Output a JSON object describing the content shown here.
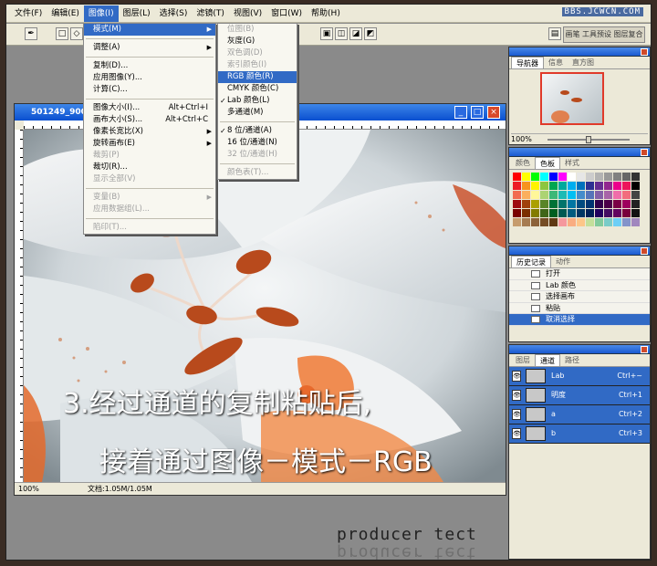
{
  "menubar": {
    "items": [
      "文件(F)",
      "编辑(E)",
      "图像(I)",
      "图层(L)",
      "选择(S)",
      "滤镜(T)",
      "视图(V)",
      "窗口(W)",
      "帮助(H)"
    ],
    "watermark": "BBS.JCWCN.COM"
  },
  "optbar": {
    "palette_well": "画笔 工具预设 图层复合"
  },
  "document": {
    "title": "501249_900",
    "zoom": "100%",
    "doc_info": "文档:1.05M/1.05M"
  },
  "image_menu": {
    "items": [
      {
        "label": "模式(M)",
        "arrow": true,
        "highlight": true
      },
      {
        "sep": true
      },
      {
        "label": "调整(A)",
        "arrow": true
      },
      {
        "sep": true
      },
      {
        "label": "复制(D)..."
      },
      {
        "label": "应用图像(Y)..."
      },
      {
        "label": "计算(C)..."
      },
      {
        "sep": true
      },
      {
        "label": "图像大小(I)...",
        "shortcut": "Alt+Ctrl+I"
      },
      {
        "label": "画布大小(S)...",
        "shortcut": "Alt+Ctrl+C"
      },
      {
        "label": "像素长宽比(X)",
        "arrow": true
      },
      {
        "label": "旋转画布(E)",
        "arrow": true
      },
      {
        "label": "裁剪(P)",
        "disabled": true
      },
      {
        "label": "裁切(R)..."
      },
      {
        "label": "显示全部(V)",
        "disabled": true
      },
      {
        "sep": true
      },
      {
        "label": "变量(B)",
        "arrow": true,
        "disabled": true
      },
      {
        "label": "应用数据组(L)...",
        "disabled": true
      },
      {
        "sep": true
      },
      {
        "label": "陷印(T)...",
        "disabled": true
      }
    ]
  },
  "mode_menu": {
    "items": [
      {
        "label": "位图(B)",
        "disabled": true
      },
      {
        "label": "灰度(G)"
      },
      {
        "label": "双色调(D)",
        "disabled": true
      },
      {
        "label": "索引颜色(I)",
        "disabled": true
      },
      {
        "label": "RGB 颜色(R)",
        "highlight": true
      },
      {
        "label": "CMYK 颜色(C)"
      },
      {
        "label": "Lab 颜色(L)",
        "checked": true
      },
      {
        "label": "多通道(M)"
      },
      {
        "sep": true
      },
      {
        "label": "8 位/通道(A)",
        "checked": true
      },
      {
        "label": "16 位/通道(N)"
      },
      {
        "label": "32 位/通道(H)",
        "disabled": true
      },
      {
        "sep": true
      },
      {
        "label": "颜色表(T)...",
        "disabled": true
      }
    ]
  },
  "navigator": {
    "tabs": [
      "导航器",
      "信息",
      "直方图"
    ],
    "zoom": "100%"
  },
  "color_panel": {
    "tabs": [
      "颜色",
      "色板",
      "样式"
    ],
    "swatches": [
      "#ff0000",
      "#ffff00",
      "#00ff00",
      "#00ffff",
      "#0000ff",
      "#ff00ff",
      "#ffffff",
      "#e6e6e6",
      "#cccccc",
      "#b3b3b3",
      "#999999",
      "#808080",
      "#666666",
      "#333333",
      "#ed1c24",
      "#f7941d",
      "#fff200",
      "#8dc63f",
      "#00a651",
      "#00a99d",
      "#00aeef",
      "#0072bc",
      "#2e3192",
      "#662d91",
      "#92278f",
      "#ec008c",
      "#ed145b",
      "#000000",
      "#f26c4f",
      "#fbaf5d",
      "#fff799",
      "#acd373",
      "#3cb878",
      "#1cbbb4",
      "#00bff3",
      "#448ccb",
      "#5674b9",
      "#8560a8",
      "#a864a8",
      "#f06eaa",
      "#f26d7d",
      "#444444",
      "#9e0b0f",
      "#a0410d",
      "#aba000",
      "#598527",
      "#007236",
      "#00746b",
      "#0076a3",
      "#004a80",
      "#003471",
      "#32004b",
      "#4b0049",
      "#7b0046",
      "#9e005d",
      "#222222",
      "#790000",
      "#7b2e00",
      "#827b00",
      "#406618",
      "#005e20",
      "#005952",
      "#005b7f",
      "#003663",
      "#002157",
      "#21005e",
      "#440e62",
      "#630460",
      "#79003d",
      "#111111",
      "#c69c6d",
      "#a67c52",
      "#8c6239",
      "#754c24",
      "#603913",
      "#f5989d",
      "#f9ad81",
      "#fdc689",
      "#c4df9b",
      "#82ca9c",
      "#7accc8",
      "#6dcff6",
      "#8393ca",
      "#a187be"
    ]
  },
  "history": {
    "tabs": [
      "历史记录",
      "动作"
    ],
    "items": [
      {
        "label": "打开"
      },
      {
        "label": "Lab 颜色"
      },
      {
        "label": "选择画布"
      },
      {
        "label": "粘贴"
      },
      {
        "label": "取消选择",
        "selected": true
      }
    ]
  },
  "channels": {
    "tabs": [
      "图层",
      "通道",
      "路径"
    ],
    "items": [
      {
        "label": "Lab",
        "shortcut": "Ctrl+~"
      },
      {
        "label": "明度",
        "shortcut": "Ctrl+1"
      },
      {
        "label": "a",
        "shortcut": "Ctrl+2"
      },
      {
        "label": "b",
        "shortcut": "Ctrl+3"
      }
    ]
  },
  "caption": {
    "line1": "3.经过通道的复制粘贴后,",
    "line2": "接着通过图像－模式－RGB"
  },
  "logo": "producer tect"
}
